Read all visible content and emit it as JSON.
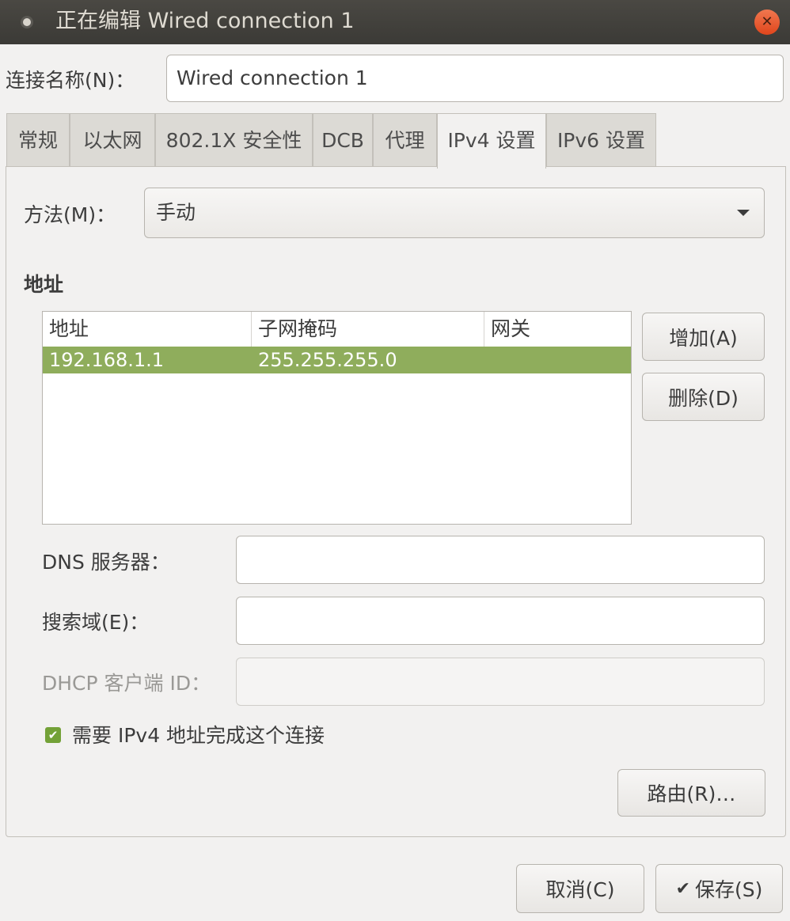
{
  "window": {
    "title": "正在编辑 Wired connection 1"
  },
  "connection": {
    "name_label": "连接名称(N)：",
    "name_value": "Wired connection 1"
  },
  "tabs": [
    {
      "label": "常规"
    },
    {
      "label": "以太网"
    },
    {
      "label": "802.1X 安全性"
    },
    {
      "label": "DCB"
    },
    {
      "label": "代理"
    },
    {
      "label": "IPv4 设置",
      "active": true
    },
    {
      "label": "IPv6 设置"
    }
  ],
  "ipv4": {
    "method_label": "方法(M)：",
    "method_value": "手动",
    "address_section_title": "地址",
    "table": {
      "headers": [
        "地址",
        "子网掩码",
        "网关"
      ],
      "rows": [
        [
          "192.168.1.1",
          "255.255.255.0",
          ""
        ]
      ]
    },
    "add_button": "增加(A)",
    "delete_button": "删除(D)",
    "dns_label": "DNS 服务器：",
    "dns_value": "",
    "search_label": "搜索域(E)：",
    "search_value": "",
    "dhcp_label": "DHCP 客户端 ID：",
    "dhcp_value": "",
    "require_checkbox_label": "需要 IPv4 地址完成这个连接",
    "require_checked": true,
    "routes_button": "路由(R)…"
  },
  "footer": {
    "cancel_button": "取消(C)",
    "save_button": "保存(S)"
  },
  "colors": {
    "titlebar": "#3b3a36",
    "selection": "#8fad5c",
    "close": "#e0461c",
    "checkbox": "#73a137"
  }
}
